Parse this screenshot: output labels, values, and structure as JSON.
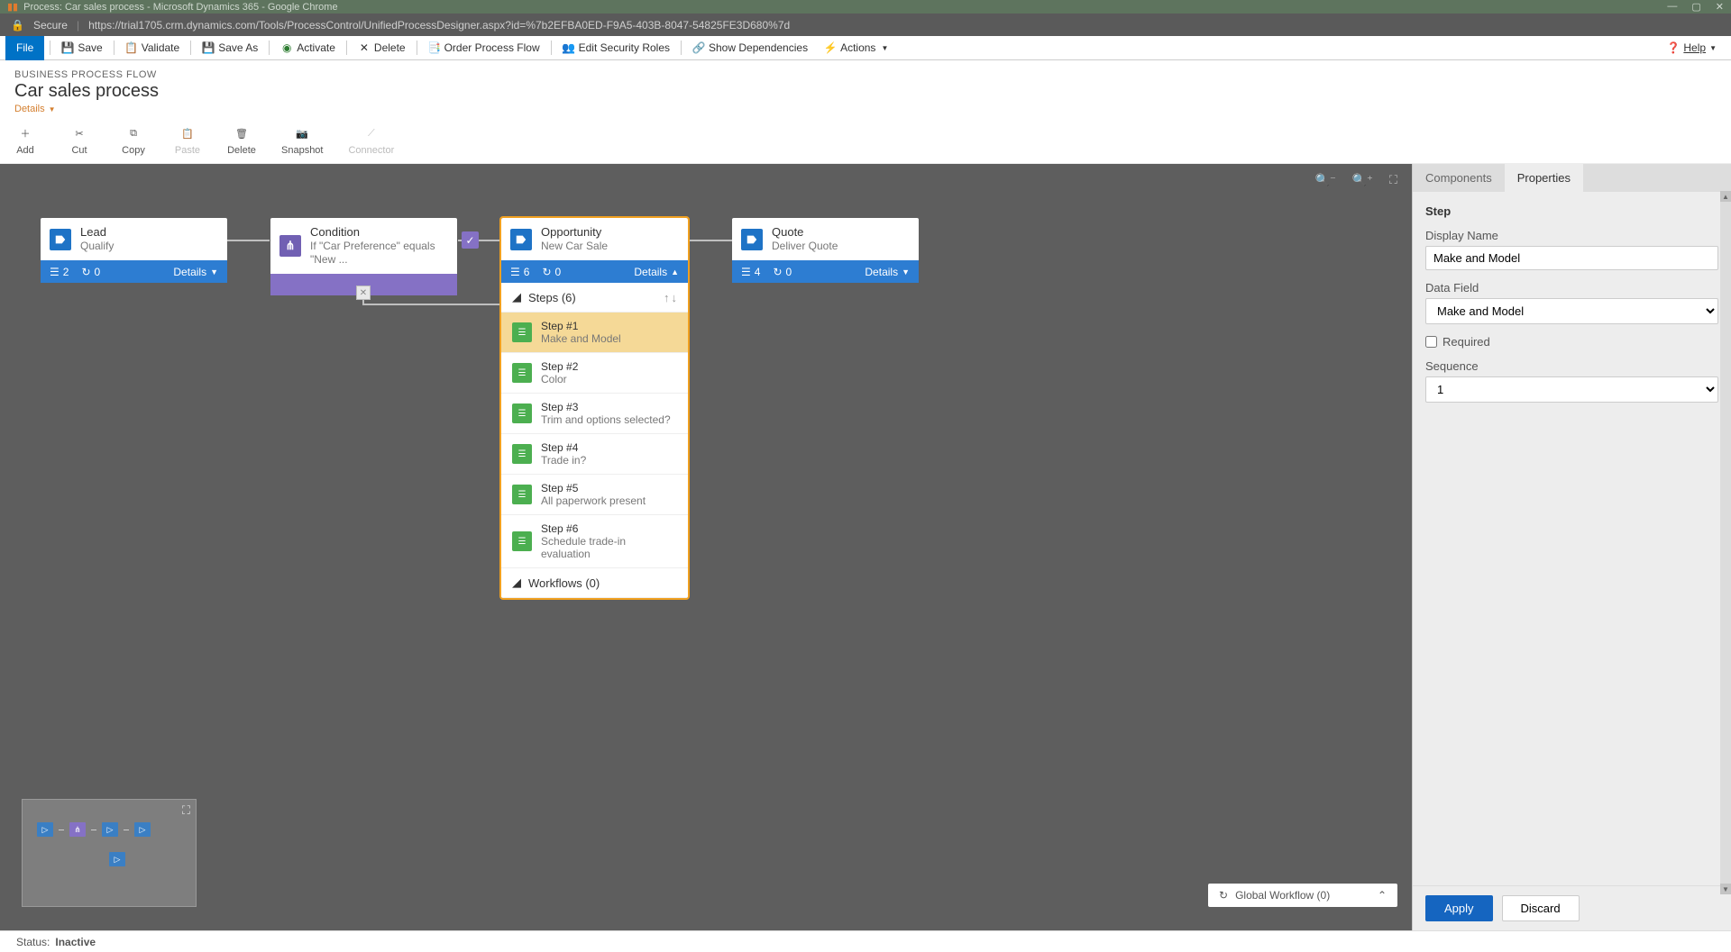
{
  "window": {
    "title": "Process: Car sales process - Microsoft Dynamics 365 - Google Chrome"
  },
  "address": {
    "secure_label": "Secure",
    "url": "https://trial1705.crm.dynamics.com/Tools/ProcessControl/UnifiedProcessDesigner.aspx?id=%7b2EFBA0ED-F9A5-403B-8047-54825FE3D680%7d"
  },
  "toolbar": {
    "file": "File",
    "save": "Save",
    "validate": "Validate",
    "save_as": "Save As",
    "activate": "Activate",
    "delete": "Delete",
    "order": "Order Process Flow",
    "edit_security": "Edit Security Roles",
    "show_deps": "Show Dependencies",
    "actions": "Actions",
    "help": "Help"
  },
  "header": {
    "label": "BUSINESS PROCESS FLOW",
    "title": "Car sales process",
    "details": "Details"
  },
  "cmd": {
    "add": "Add",
    "cut": "Cut",
    "copy": "Copy",
    "paste": "Paste",
    "delete": "Delete",
    "snapshot": "Snapshot",
    "connector": "Connector"
  },
  "nodes": {
    "lead": {
      "title": "Lead",
      "sub": "Qualify",
      "stat1": "2",
      "stat2": "0",
      "details": "Details"
    },
    "condition": {
      "title": "Condition",
      "sub": "If \"Car Preference\" equals \"New ..."
    },
    "opportunity": {
      "title": "Opportunity",
      "sub": "New Car Sale",
      "stat1": "6",
      "stat2": "0",
      "details": "Details",
      "steps_label": "Steps (6)",
      "workflows_label": "Workflows (0)"
    },
    "quote": {
      "title": "Quote",
      "sub": "Deliver Quote",
      "stat1": "4",
      "stat2": "0",
      "details": "Details"
    }
  },
  "steps": [
    {
      "name": "Step #1",
      "desc": "Make and Model"
    },
    {
      "name": "Step #2",
      "desc": "Color"
    },
    {
      "name": "Step #3",
      "desc": "Trim and options selected?"
    },
    {
      "name": "Step #4",
      "desc": "Trade in?"
    },
    {
      "name": "Step #5",
      "desc": "All paperwork present"
    },
    {
      "name": "Step #6",
      "desc": "Schedule trade-in evaluation"
    }
  ],
  "global_workflow": "Global Workflow (0)",
  "properties": {
    "tabs": {
      "components": "Components",
      "properties": "Properties"
    },
    "section": "Step",
    "display_name_label": "Display Name",
    "display_name_value": "Make and Model",
    "data_field_label": "Data Field",
    "data_field_value": "Make and Model",
    "required_label": "Required",
    "sequence_label": "Sequence",
    "sequence_value": "1",
    "apply": "Apply",
    "discard": "Discard"
  },
  "status": {
    "label": "Status:",
    "value": "Inactive"
  }
}
